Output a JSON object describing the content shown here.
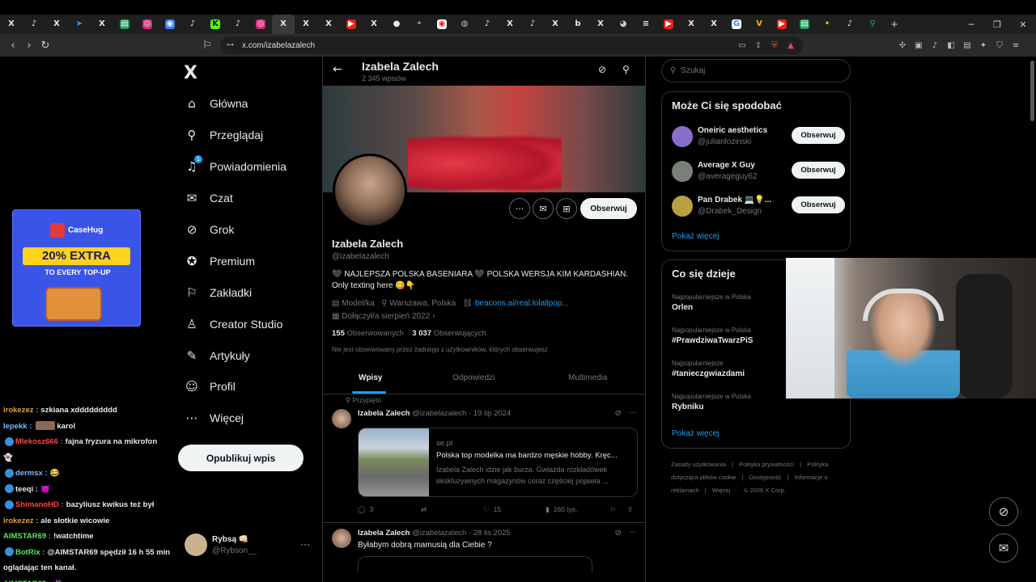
{
  "browser": {
    "tabs": [
      {
        "icon": "x-icon",
        "glyph": "X",
        "color": "#e7e9ea",
        "bg": ""
      },
      {
        "icon": "tiktok-icon",
        "glyph": "♪",
        "color": "#e7e9ea",
        "bg": ""
      },
      {
        "icon": "x-icon",
        "glyph": "X",
        "color": "#e7e9ea",
        "bg": ""
      },
      {
        "icon": "telegram-icon",
        "glyph": "➤",
        "color": "#2aa3e0",
        "bg": ""
      },
      {
        "icon": "x-icon",
        "glyph": "X",
        "color": "#e7e9ea",
        "bg": ""
      },
      {
        "icon": "sheets-icon",
        "glyph": "▤",
        "color": "#ffffff",
        "bg": "#1e9e5a"
      },
      {
        "icon": "instagram-icon",
        "glyph": "◎",
        "color": "#ffffff",
        "bg": "#d62976"
      },
      {
        "icon": "messenger-icon",
        "glyph": "◉",
        "color": "#ffffff",
        "bg": "#3b7ef6"
      },
      {
        "icon": "tiktok-icon",
        "glyph": "♪",
        "color": "#e7e9ea",
        "bg": ""
      },
      {
        "icon": "kick-icon",
        "glyph": "K",
        "color": "#000000",
        "bg": "#53fc18"
      },
      {
        "icon": "tiktok-icon",
        "glyph": "♪",
        "color": "#e7e9ea",
        "bg": ""
      },
      {
        "icon": "instagram-icon",
        "glyph": "◎",
        "color": "#ffffff",
        "bg": "#d62976"
      },
      {
        "icon": "x-icon",
        "glyph": "X",
        "color": "#e7e9ea",
        "bg": "",
        "active": true
      },
      {
        "icon": "x-icon",
        "glyph": "X",
        "color": "#e7e9ea",
        "bg": ""
      },
      {
        "icon": "x-icon",
        "glyph": "X",
        "color": "#e7e9ea",
        "bg": ""
      },
      {
        "icon": "youtube-icon",
        "glyph": "▶",
        "color": "#ffffff",
        "bg": "#e62117"
      },
      {
        "icon": "x-icon",
        "glyph": "X",
        "color": "#e7e9ea",
        "bg": ""
      },
      {
        "icon": "chat-icon",
        "glyph": "●",
        "color": "#e7e9ea",
        "bg": ""
      },
      {
        "icon": "misc-icon",
        "glyph": "•",
        "color": "#9a9a6a",
        "bg": ""
      },
      {
        "icon": "record-icon",
        "glyph": "◉",
        "color": "#e62117",
        "bg": "#ffffff"
      },
      {
        "icon": "globe-icon",
        "glyph": "◍",
        "color": "#bbbbbb",
        "bg": ""
      },
      {
        "icon": "tiktok-icon",
        "glyph": "♪",
        "color": "#e7e9ea",
        "bg": ""
      },
      {
        "icon": "x-icon",
        "glyph": "X",
        "color": "#e7e9ea",
        "bg": ""
      },
      {
        "icon": "tiktok-icon",
        "glyph": "♪",
        "color": "#e7e9ea",
        "bg": ""
      },
      {
        "icon": "x-icon",
        "glyph": "X",
        "color": "#e7e9ea",
        "bg": ""
      },
      {
        "icon": "b-icon",
        "glyph": "b",
        "color": "#e7e9ea",
        "bg": ""
      },
      {
        "icon": "x-icon",
        "glyph": "X",
        "color": "#e7e9ea",
        "bg": ""
      },
      {
        "icon": "github-icon",
        "glyph": "◕",
        "color": "#cccccc",
        "bg": ""
      },
      {
        "icon": "stack-icon",
        "glyph": "≡",
        "color": "#e7e9ea",
        "bg": ""
      },
      {
        "icon": "youtube-icon",
        "glyph": "▶",
        "color": "#ffffff",
        "bg": "#e62117"
      },
      {
        "icon": "x-icon",
        "glyph": "X",
        "color": "#e7e9ea",
        "bg": ""
      },
      {
        "icon": "x-icon",
        "glyph": "X",
        "color": "#e7e9ea",
        "bg": ""
      },
      {
        "icon": "google-icon",
        "glyph": "G",
        "color": "#4285f4",
        "bg": "#ffffff"
      },
      {
        "icon": "v-icon",
        "glyph": "V",
        "color": "#f5b400",
        "bg": ""
      },
      {
        "icon": "youtube-icon",
        "glyph": "▶",
        "color": "#ffffff",
        "bg": "#e62117"
      },
      {
        "icon": "sheets-icon",
        "glyph": "▤",
        "color": "#ffffff",
        "bg": "#1e9e5a"
      },
      {
        "icon": "misc-icon",
        "glyph": "•",
        "color": "#f5b400",
        "bg": ""
      },
      {
        "icon": "tiktok-icon",
        "glyph": "♪",
        "color": "#e7e9ea",
        "bg": ""
      },
      {
        "icon": "maps-icon",
        "glyph": "⚲",
        "color": "#34a853",
        "bg": ""
      }
    ],
    "url": "x.com/izabelazalech"
  },
  "nav": {
    "items": [
      {
        "label": "Główna",
        "icon": "home-icon",
        "glyph": "⌂"
      },
      {
        "label": "Przeglądaj",
        "icon": "search-icon",
        "glyph": "⚲"
      },
      {
        "label": "Powiadomienia",
        "icon": "bell-icon",
        "glyph": "♫",
        "badge": "1"
      },
      {
        "label": "Czat",
        "icon": "mail-icon",
        "glyph": "✉"
      },
      {
        "label": "Grok",
        "icon": "grok-icon",
        "glyph": "⊘"
      },
      {
        "label": "Premium",
        "icon": "premium-icon",
        "glyph": "✪"
      },
      {
        "label": "Zakładki",
        "icon": "bookmark-icon",
        "glyph": "⚐"
      },
      {
        "label": "Creator Studio",
        "icon": "creator-icon",
        "glyph": "♙"
      },
      {
        "label": "Artykuły",
        "icon": "article-icon",
        "glyph": "✎"
      },
      {
        "label": "Profil",
        "icon": "profile-icon",
        "glyph": "☺"
      },
      {
        "label": "Więcej",
        "icon": "more-icon",
        "glyph": "⋯"
      }
    ],
    "post_label": "Opublikuj wpis",
    "account": {
      "name": "Rybsą 👊🏻",
      "handle": "@Rybson__"
    }
  },
  "ad": {
    "brand": "CaseHug",
    "headline": "20% EXTRA",
    "sub": "TO EVERY TOP-UP"
  },
  "chat": [
    {
      "user": "irokezez :",
      "text": "szkiana xddddddddd",
      "color": "#e2a33b"
    },
    {
      "user": "lepekk :",
      "text": "karol",
      "color": "#7fb8ff",
      "emote": true
    },
    {
      "user": "Mlekosz666 :",
      "text": "fajna fryzura na mikrofon",
      "color": "#ff4545",
      "badges": true
    },
    {
      "user": "",
      "text": "👻",
      "color": "#e7e9ea"
    },
    {
      "user": "dermsx :",
      "text": "😂",
      "color": "#7fb8ff",
      "badges": true
    },
    {
      "user": "teeqi :",
      "text": "😈",
      "color": "#e7e9ea",
      "badges": true
    },
    {
      "user": "ShimanoHD :",
      "text": "bazyliusz kwikus też był",
      "color": "#ff4545",
      "badges": true
    },
    {
      "user": "irokezez :",
      "text": "ale słotkie wicowie",
      "color": "#e2a33b"
    },
    {
      "user": "AIMSTAR69 :",
      "text": "!watchtime",
      "color": "#5ce65c"
    },
    {
      "user": "BotRix :",
      "text": "@AIMSTAR69 spędził 16 h 55 min",
      "color": "#5ce65c",
      "badges": true
    },
    {
      "user": "",
      "text": "oglądając ten kanał.",
      "color": "#e7e9ea"
    },
    {
      "user": "AIMSTAR69 :",
      "text": "👾",
      "color": "#5ce65c"
    }
  ],
  "profile": {
    "header_name": "Izabela Zalech",
    "post_count": "2 345 wpisów",
    "follow_label": "Obserwuj",
    "name": "Izabela Zalech",
    "handle": "@izabelazalech",
    "bio": "🖤 NAJLEPSZA POLSKA BASENIARA 🖤 POLSKA WERSJA KIM KARDASHIAN. Only texting here 😋👇",
    "category": "Model/ka",
    "location": "Warszawa, Polska",
    "link": "beacons.ai/real.lolallpop...",
    "joined": "Dołączył/a sierpień 2022",
    "following_count": "155",
    "following_label": "Obserwowanych",
    "followers_count": "3 037",
    "followers_label": "Obserwujących",
    "not_followed": "Nie jest obserwowany przez żadnego z użytkowników, których obserwujesz",
    "tabs": [
      "Wpisy",
      "Odpowiedzi",
      "Multimedia"
    ]
  },
  "posts": [
    {
      "pinned_label": "Przypięto",
      "name": "Izabela Zalech",
      "handle": "@izabelazalech",
      "date": "· 19 lip 2024",
      "card_domain": "se.pl",
      "card_title": "Polska top modelka ma bardzo męskie hobby. Kręc...",
      "card_desc": "Izabela Zalech idzie jak burza. Gwiazda rozkładówek ekskluzywnych magazynów coraz częściej pojawia ...",
      "replies": "3",
      "likes": "15",
      "views": "160 tys."
    },
    {
      "name": "Izabela Zalech",
      "handle": "@izabelazalech",
      "date": "· 28 lis 2025",
      "text": "Byłabym  dobrą mamusią dla Ciebie ?"
    }
  ],
  "sidebar": {
    "search_placeholder": "Szukaj",
    "suggest_title": "Może Ci się spodobać",
    "suggestions": [
      {
        "name": "Oneiric aesthetics",
        "handle": "@julianlozinski",
        "color": "#8a6fc9"
      },
      {
        "name": "Average X Guy",
        "handle": "@averageguy62",
        "color": "#7a7f7a"
      },
      {
        "name": "Pan Drabek 💻💡...",
        "handle": "@Drabek_Design",
        "color": "#b8a040"
      }
    ],
    "suggest_follow": "Obserwuj",
    "show_more": "Pokaż więcej",
    "trends_title": "Co się dzieje",
    "trends": [
      {
        "context": "Najpopularniejsze w Polska",
        "name": "Orlen"
      },
      {
        "context": "Najpopularniejsze w Polska",
        "name": "#PrawdziwaTwarzPiS"
      },
      {
        "context": "Najpopularniejsze",
        "name": "#tanieczgwiazdami"
      },
      {
        "context": "Najpopularniejsze w Polska",
        "name": "Rybniku"
      }
    ],
    "trends_more": "Pokaż więcej",
    "footer": [
      "Zasady użytkowania",
      "|",
      "Polityka prywatności",
      "|",
      "Polityka dotycząca plików cookie",
      "|",
      "Dostępność",
      "|",
      "Informacje o reklamach",
      "|",
      "Więcej ···",
      "© 2026 X Corp."
    ]
  }
}
